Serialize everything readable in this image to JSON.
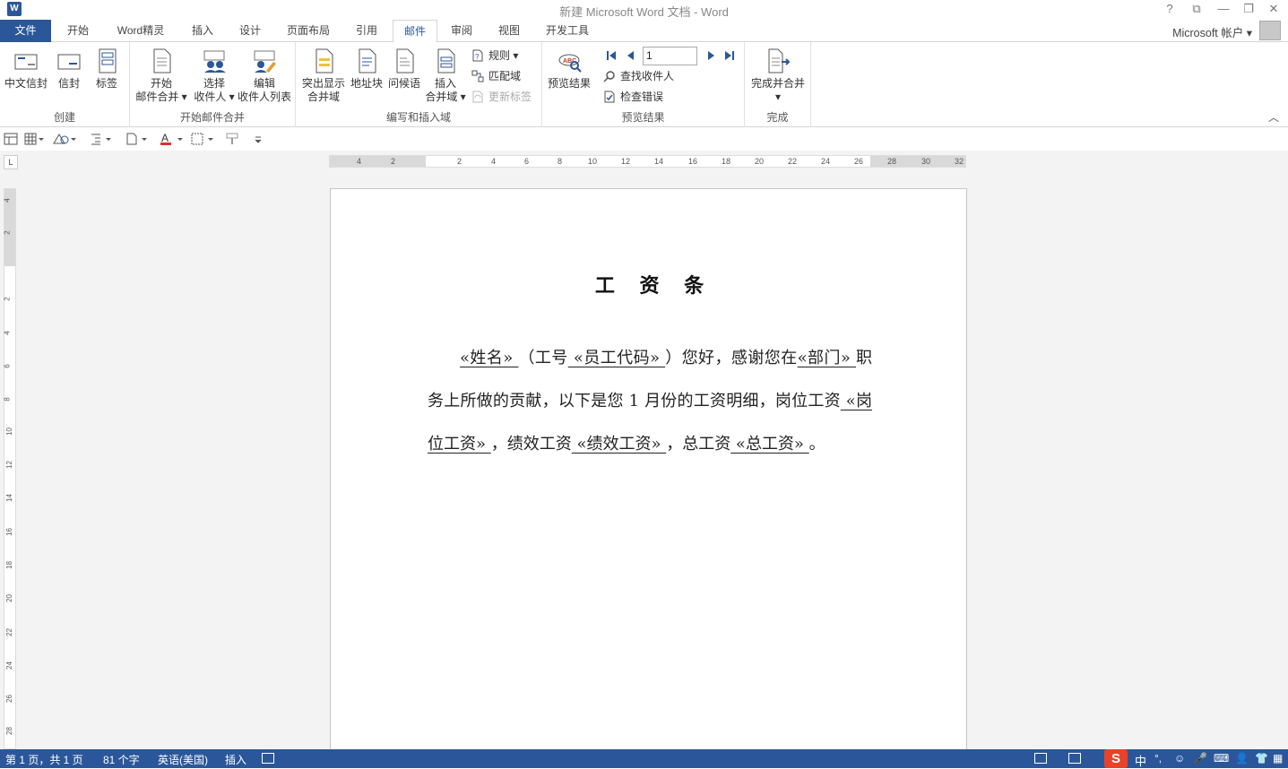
{
  "window": {
    "title": "新建 Microsoft Word 文档 - Word",
    "app_icon": "W",
    "help": "?",
    "restore_ribbon": "⧉",
    "minimize": "—",
    "maximize": "❐",
    "close": "✕"
  },
  "tabs": [
    "文件",
    "开始",
    "Word精灵",
    "插入",
    "设计",
    "页面布局",
    "引用",
    "邮件",
    "审阅",
    "视图",
    "开发工具"
  ],
  "active_tab": "邮件",
  "account": "Microsoft 帐户",
  "ribbon": {
    "groups": {
      "create": "创建",
      "start_merge": "开始邮件合并",
      "write_insert": "编写和插入域",
      "preview": "预览结果",
      "finish": "完成"
    },
    "create": {
      "chinese_envelope": "中文信封",
      "envelope": "信封",
      "labels": "标签"
    },
    "start_merge": {
      "start_l1": "开始",
      "start_l2": "邮件合并",
      "select_l1": "选择",
      "select_l2": "收件人",
      "edit_l1": "编辑",
      "edit_l2": "收件人列表"
    },
    "write_insert": {
      "highlight_l1": "突出显示",
      "highlight_l2": "合并域",
      "address_block": "地址块",
      "greeting": "问候语",
      "insert_l1": "插入",
      "insert_l2": "合并域",
      "rules": "规则",
      "match_fields": "匹配域",
      "update_labels": "更新标签"
    },
    "preview": {
      "preview_results": "预览结果",
      "record_number": "1",
      "find_recipient": "查找收件人",
      "check_errors": "检查错误"
    },
    "finish": {
      "finish_merge": "完成并合并"
    }
  },
  "ruler": {
    "h_ticks": [
      "4",
      "2",
      "2",
      "4",
      "6",
      "8",
      "10",
      "12",
      "14",
      "16",
      "18",
      "20",
      "22",
      "24",
      "26",
      "28",
      "30",
      "32"
    ],
    "v_ticks": [
      "4",
      "2",
      "2",
      "4",
      "6",
      "8",
      "10",
      "12",
      "14",
      "16",
      "18",
      "20",
      "22",
      "24",
      "26",
      "28"
    ]
  },
  "document": {
    "title": "工 资 条",
    "body": [
      {
        "t": "text",
        "v": "  "
      },
      {
        "t": "field",
        "v": "  «姓名»   "
      },
      {
        "t": "text",
        "v": "（工号"
      },
      {
        "t": "field",
        "v": " «员工代码» "
      },
      {
        "t": "text",
        "v": "）您好，感谢您在"
      },
      {
        "t": "field",
        "v": "«部门»  "
      },
      {
        "t": "text",
        "v": " 职务上所做的贡献，以下是您 1 月份的工资明细，岗位工资"
      },
      {
        "t": "field",
        "v": "  «岗位工资»  "
      },
      {
        "t": "text",
        "v": "，绩效工资"
      },
      {
        "t": "field",
        "v": "  «绩效工资»  "
      },
      {
        "t": "text",
        "v": "，总工资"
      },
      {
        "t": "field",
        "v": "  «总工资»  "
      },
      {
        "t": "text",
        "v": "。"
      }
    ]
  },
  "status": {
    "page": "第 1 页，共 1 页",
    "words": "81 个字",
    "language": "英语(美国)",
    "mode": "插入",
    "ime": "中"
  },
  "colors": {
    "accent": "#2b579a",
    "ime_red": "#e8422a"
  }
}
